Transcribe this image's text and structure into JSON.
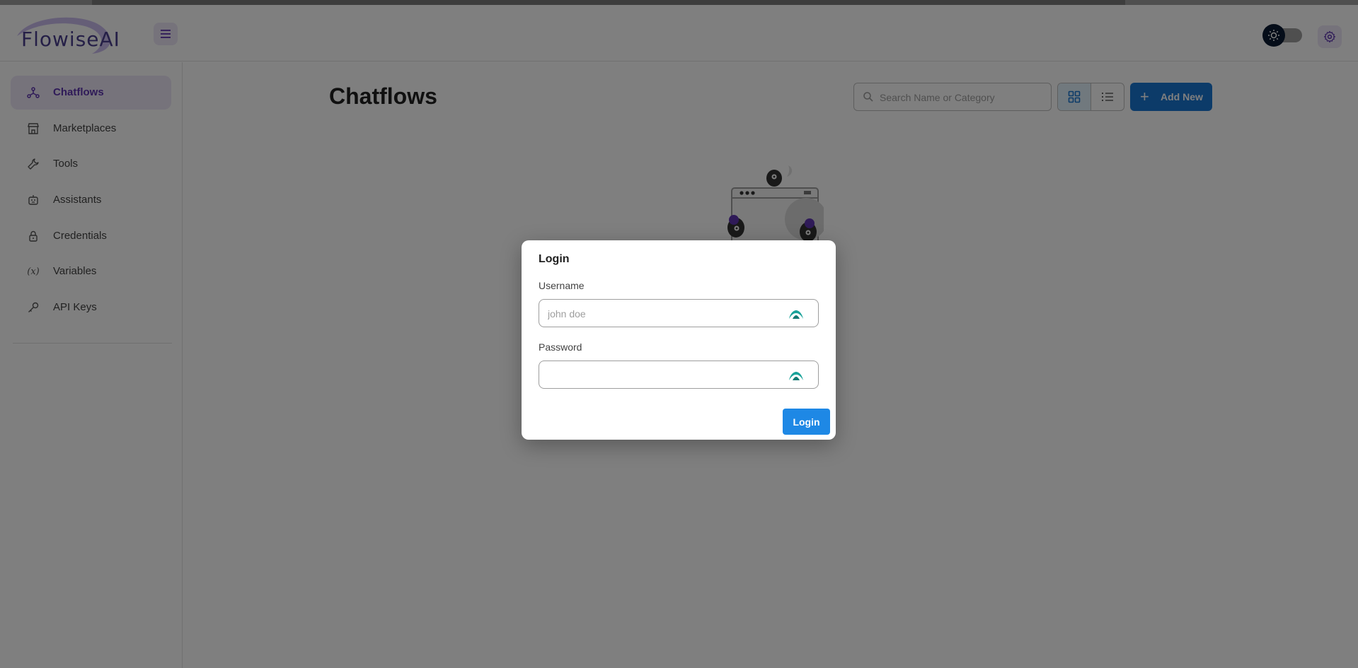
{
  "header": {
    "logo_text": "FlowiseAI",
    "menu_icon": "hamburger-icon",
    "theme_toggle_icon": "sun-icon",
    "settings_icon": "gear-icon"
  },
  "sidebar": {
    "items": [
      {
        "label": "Chatflows",
        "icon": "chatflows-icon",
        "active": true
      },
      {
        "label": "Marketplaces",
        "icon": "store-icon",
        "active": false
      },
      {
        "label": "Tools",
        "icon": "wrench-icon",
        "active": false
      },
      {
        "label": "Assistants",
        "icon": "robot-icon",
        "active": false
      },
      {
        "label": "Credentials",
        "icon": "lock-icon",
        "active": false
      },
      {
        "label": "Variables",
        "icon": "variable-icon",
        "active": false
      },
      {
        "label": "API Keys",
        "icon": "key-icon",
        "active": false
      }
    ]
  },
  "main": {
    "title": "Chatflows",
    "search": {
      "placeholder": "Search Name or Category",
      "value": ""
    },
    "view_toggle": {
      "active": "grid"
    },
    "add_button_label": "Add New"
  },
  "login_dialog": {
    "title": "Login",
    "username_label": "Username",
    "username_placeholder": "john doe",
    "username_value": "",
    "password_label": "Password",
    "password_value": "",
    "submit_label": "Login"
  },
  "colors": {
    "accent_purple": "#5e35b1",
    "primary_blue": "#1976d2",
    "login_button": "#1e88e5",
    "active_nav_bg": "#ede7f6"
  }
}
